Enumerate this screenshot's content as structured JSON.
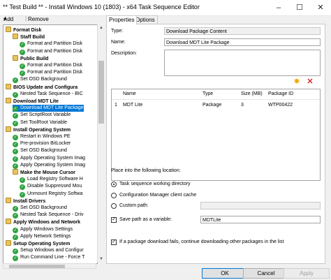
{
  "window": {
    "title": "** Test Build ** - Install Windows 10 (1803) - x64 Task Sequence Editor"
  },
  "toolbar": {
    "add_label": "Add",
    "add_arrow": "▾",
    "remove_label": "Remove"
  },
  "tabs": [
    {
      "label": "Properties"
    },
    {
      "label": "Options"
    }
  ],
  "tree": [
    {
      "label": "Format Disk",
      "kind": "group",
      "level": 0
    },
    {
      "label": "Staff Build",
      "kind": "group",
      "level": 1
    },
    {
      "label": "Format and Partition Disk",
      "kind": "step",
      "level": 2
    },
    {
      "label": "Format and Partition Disk",
      "kind": "step",
      "level": 2
    },
    {
      "label": "Public Build",
      "kind": "group",
      "level": 1
    },
    {
      "label": "Format and Partition Disk",
      "kind": "step",
      "level": 2
    },
    {
      "label": "Format and Partition Disk",
      "kind": "step",
      "level": 2
    },
    {
      "label": "Set OSD Background",
      "kind": "step",
      "level": 1
    },
    {
      "label": "BIOS Update and Configura",
      "kind": "group",
      "level": 0
    },
    {
      "label": "Nested Task Sequence - BIC",
      "kind": "step",
      "level": 1
    },
    {
      "label": "Download MDT Lite",
      "kind": "group",
      "level": 0
    },
    {
      "label": "Download MDT Lite Package",
      "kind": "step",
      "level": 1,
      "selected": true
    },
    {
      "label": "Set ScriptRoot Variable",
      "kind": "step",
      "level": 1
    },
    {
      "label": "Set ToolRoot Variable",
      "kind": "step",
      "level": 1
    },
    {
      "label": "Install Operating System",
      "kind": "group",
      "level": 0
    },
    {
      "label": "Restart in Windows PE",
      "kind": "step",
      "level": 1
    },
    {
      "label": "Pre-provision BitLocker",
      "kind": "step",
      "level": 1
    },
    {
      "label": "Set OSD Background",
      "kind": "step",
      "level": 1
    },
    {
      "label": "Apply Operating System Imag",
      "kind": "step",
      "level": 1
    },
    {
      "label": "Apply Operating System Imag",
      "kind": "step",
      "level": 1
    },
    {
      "label": "Make the Mouse Cursor",
      "kind": "group",
      "level": 1
    },
    {
      "label": "Load Registry Software H",
      "kind": "step",
      "level": 2
    },
    {
      "label": "Disable Suppressed Mou",
      "kind": "step",
      "level": 2
    },
    {
      "label": "Unmount Registry Softwa",
      "kind": "step",
      "level": 2
    },
    {
      "label": "Install Drivers",
      "kind": "group",
      "level": 0
    },
    {
      "label": "Set OSD Background",
      "kind": "step",
      "level": 1
    },
    {
      "label": "Nested Task Sequence - Driv",
      "kind": "step",
      "level": 1
    },
    {
      "label": "Apply Windows and Network",
      "kind": "group",
      "level": 0
    },
    {
      "label": "Apply Windows Settings",
      "kind": "step",
      "level": 1
    },
    {
      "label": "Apply Network Settings",
      "kind": "step",
      "level": 1
    },
    {
      "label": "Setup Operating System",
      "kind": "group",
      "level": 0
    },
    {
      "label": "Setup Windows and Configur",
      "kind": "step",
      "level": 1
    },
    {
      "label": "Run Command Line - Force T",
      "kind": "step",
      "level": 1
    }
  ],
  "props": {
    "type_label": "Type:",
    "type_value": "Download Package Content",
    "name_label": "Name:",
    "name_value": "Download MDT Lite Package",
    "description_label": "Description:",
    "packages": {
      "columns": [
        "Name",
        "Type",
        "Size (MB)",
        "Package ID"
      ],
      "rows": [
        {
          "index": "1",
          "name": "MDT Lite",
          "type": "Package",
          "size": "3",
          "package_id": "WTP00422"
        }
      ]
    },
    "place_label": "Place into the following location:",
    "option_working_dir": "Task sequence working directory",
    "option_client_cache": "Configuration Manager client cache",
    "option_custom_path": "Custom path:",
    "save_path_label": "Save path as a variable:",
    "save_path_value": "MDTLite",
    "continue_label": "If a package download fails, continue downloading other packages in the list"
  },
  "buttons": {
    "ok": "OK",
    "cancel": "Cancel",
    "apply": "Apply"
  },
  "colors": {
    "selection": "#0078d7",
    "folder": "#e8c45a",
    "check": "#2fa340",
    "delete": "#d62b2b",
    "add_star": "#f2a900"
  }
}
